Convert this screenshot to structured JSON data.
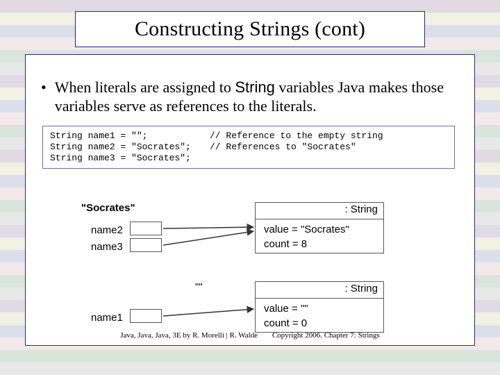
{
  "title": "Constructing Strings (cont)",
  "bullet_text_before": "When literals are assigned to ",
  "bullet_code_word": "String",
  "bullet_text_after": " variables Java makes those variables serve as references to the literals.",
  "code": {
    "l1_lhs": "String name1 = \"\";",
    "l1_cmt": "// Reference to the empty string",
    "l2_lhs": "String name2 = \"Socrates\";",
    "l2_cmt": "// References to \"Socrates\"",
    "l3_lhs": "String name3 = \"Socrates\";"
  },
  "diagram": {
    "literal_socrates": "\"Socrates\"",
    "literal_empty": "\"\"",
    "var_name1": "name1",
    "var_name2": "name2",
    "var_name3": "name3",
    "obj_header": ": String",
    "obj1_attr1": "value = \"Socrates\"",
    "obj1_attr2": "count = 8",
    "obj2_attr1": "value = \"\"",
    "obj2_attr2": "count = 0"
  },
  "footer_left": "Java, Java, Java, 3E by R. Morelli | R. Walde",
  "footer_right": "Copyright 2006.  Chapter 7: Strings"
}
